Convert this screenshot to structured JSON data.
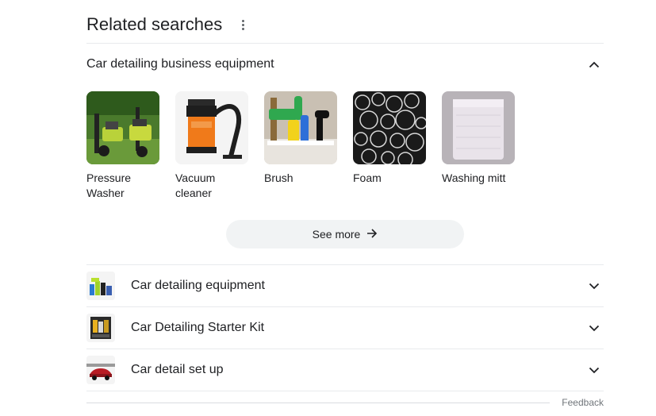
{
  "header": {
    "title": "Related searches"
  },
  "expanded": {
    "label": "Car detailing business equipment",
    "items": [
      {
        "caption": "Pressure Washer",
        "image": "pressure-washer-image"
      },
      {
        "caption": "Vacuum cleaner",
        "image": "vacuum-cleaner-image"
      },
      {
        "caption": "Brush",
        "image": "brush-image"
      },
      {
        "caption": "Foam",
        "image": "foam-image"
      },
      {
        "caption": "Washing mitt",
        "image": "washing-mitt-image"
      }
    ],
    "see_more_label": "See more"
  },
  "collapsed": [
    {
      "label": "Car detailing equipment",
      "icon": "car-detailing-equipment-thumb"
    },
    {
      "label": "Car Detailing Starter Kit",
      "icon": "starter-kit-thumb"
    },
    {
      "label": "Car detail set up",
      "icon": "car-setup-thumb"
    }
  ],
  "footer": {
    "feedback_label": "Feedback"
  },
  "colors": {
    "text": "#202124",
    "secondary": "#5f6368",
    "divider": "#e8eaed",
    "chip_bg": "#f1f3f4"
  }
}
